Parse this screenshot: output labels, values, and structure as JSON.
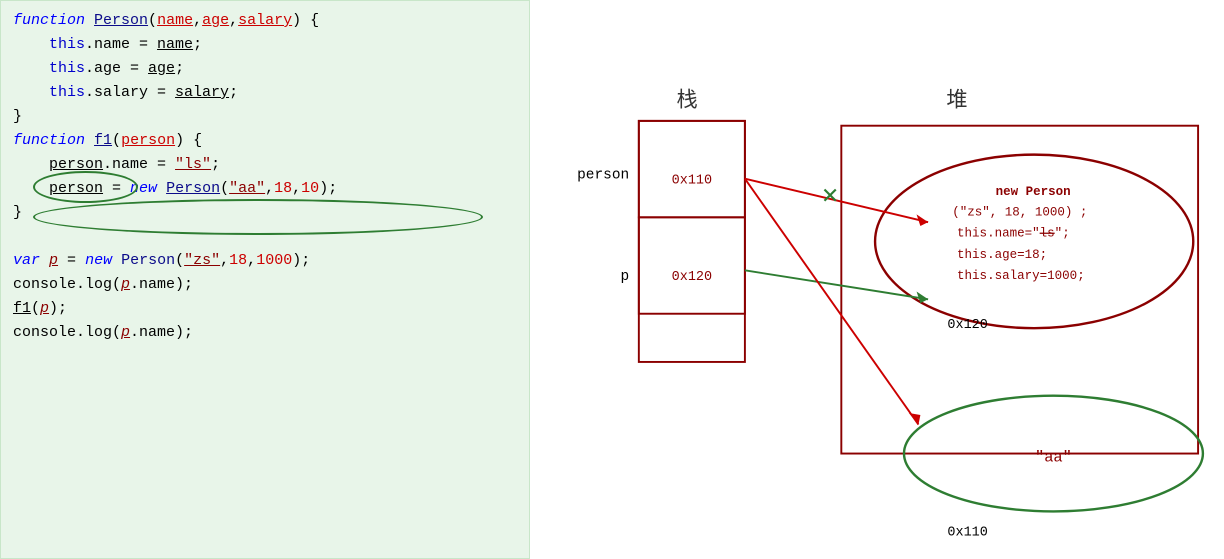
{
  "code": {
    "lines": [
      {
        "id": "l1",
        "html": "<span class='kw'>function</span> <span class='fn-name'><span class='underline'>Person</span></span>(<span class='param underline'>name</span>,<span class='param underline'>age</span>,<span class='param underline'>salary</span>) {"
      },
      {
        "id": "l2",
        "html": "    <span class='this-kw'>this</span>.name = <span class='underline'>name</span>;"
      },
      {
        "id": "l3",
        "html": "    <span class='this-kw'>this</span>.age = <span class='underline'>age</span>;"
      },
      {
        "id": "l4",
        "html": "    <span class='this-kw'>this</span>.salary = <span class='underline'>salary</span>;"
      },
      {
        "id": "l5",
        "html": "}"
      },
      {
        "id": "l6",
        "html": "<span class='kw'>function</span> <span class='fn-name'><span class='underline'>f1</span></span>(<span class='param underline'>person</span>) {"
      },
      {
        "id": "l7",
        "html": "    <span class='underline'>person</span>.name = <span class='string'>\"ls\"</span>;"
      },
      {
        "id": "l8",
        "html": "    <span class='underline'>person</span> = <span class='kw'>new</span> <span class='fn-name underline'>Person</span>(<span class='string'>\"aa\"</span>,<span class='number'>18</span>,<span class='number'>10</span>);"
      },
      {
        "id": "l9",
        "html": "}"
      },
      {
        "id": "l10",
        "html": ""
      },
      {
        "id": "l11",
        "html": "<span class='var-kw'>var</span> <span class='var-name underline'>p</span> = <span class='kw'>new</span> <span class='fn-name'>Person</span>(<span class='string'>\"zs\"</span>,<span class='number'>18</span>,<span class='number'>1000</span>);"
      },
      {
        "id": "l12",
        "html": "console.log(<span class='var-name underline'>p</span>.name);"
      },
      {
        "id": "l13",
        "html": "<span class='underline'>f1</span>(<span class='var-name underline'>p</span>);"
      },
      {
        "id": "l14",
        "html": "console.log(<span class='var-name underline'>p</span>.name);"
      }
    ]
  },
  "diagram": {
    "stack_label": "栈",
    "heap_label": "堆",
    "address_person": "0x110",
    "address_p": "0x120",
    "heap_address": "0x120",
    "heap_address2": "0x110",
    "stack_person_label": "person",
    "stack_p_label": "p",
    "heap_content_line1": "new Person",
    "heap_content_line2": "(\"zs\", 18, 1000) ;",
    "heap_content_line3": "this.name=\"ls\";",
    "heap_content_line4": "this.age=18;",
    "heap_content_line5": "this.salary=1000;",
    "heap_aa_label": "\"aa\""
  }
}
